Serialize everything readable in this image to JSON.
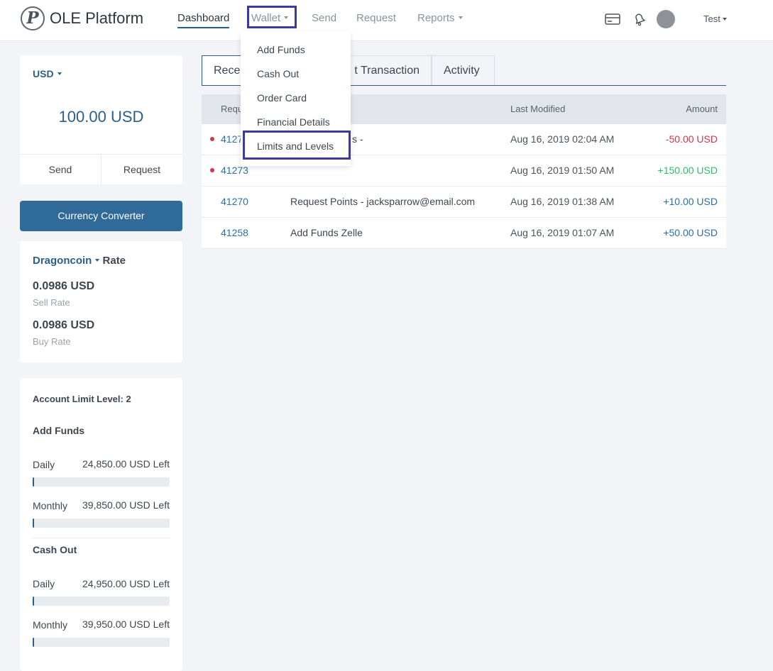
{
  "header": {
    "logo_letter": "P",
    "brand": "OLE Platform",
    "nav": {
      "dashboard": "Dashboard",
      "wallet": "Wallet",
      "send": "Send",
      "request": "Request",
      "reports": "Reports"
    },
    "user": "Test"
  },
  "wallet_menu": {
    "items": [
      "Add Funds",
      "Cash Out",
      "Order Card",
      "Financial Details",
      "Limits and Levels"
    ]
  },
  "balance": {
    "currency": "USD",
    "amount": "100.00 USD",
    "send": "Send",
    "request": "Request"
  },
  "converter": {
    "label": "Currency Converter"
  },
  "rate": {
    "coin": "Dragoncoin",
    "title_suffix": "Rate",
    "sell_value": "0.0986 USD",
    "sell_label": "Sell Rate",
    "buy_value": "0.0986 USD",
    "buy_label": "Buy Rate"
  },
  "limits": {
    "title_label": "Account Limit Level:",
    "level": "2",
    "add_funds": {
      "title": "Add Funds",
      "daily_label": "Daily",
      "daily_value": "24,850.00 USD Left",
      "daily_used_fraction": 0.01,
      "monthly_label": "Monthly",
      "monthly_value": "39,850.00 USD Left",
      "monthly_used_fraction": 0.004
    },
    "cash_out": {
      "title": "Cash Out",
      "daily_label": "Daily",
      "daily_value": "24,950.00 USD Left",
      "daily_used_fraction": 0.002,
      "monthly_label": "Monthly",
      "monthly_value": "39,950.00 USD Left",
      "monthly_used_fraction": 0.001
    }
  },
  "tabs": {
    "recent": "Recent",
    "transaction": "t Transaction",
    "activity": "Activity"
  },
  "table": {
    "headers": {
      "id": "Requ",
      "last_modified": "Last Modified",
      "amount": "Amount"
    },
    "rows": [
      {
        "id": "4127",
        "desc": "s -",
        "date": "Aug 16, 2019 02:04 AM",
        "amount": "-50.00 USD"
      },
      {
        "id": "41273",
        "desc": "",
        "date": "Aug 16, 2019 01:50 AM",
        "amount": "+150.00 USD"
      },
      {
        "id": "41270",
        "desc": "Request Points - jacksparrow@email.com",
        "date": "Aug 16, 2019 01:38 AM",
        "amount": "+10.00 USD"
      },
      {
        "id": "41258",
        "desc": "Add Funds Zelle",
        "date": "Aug 16, 2019 01:07 AM",
        "amount": "+50.00 USD"
      }
    ]
  },
  "colors": {
    "primary": "#2c5f88",
    "button": "#2f6a99",
    "negative": "#d63447",
    "positive": "#2ebd6b",
    "highlight": "#3a3aa0"
  }
}
